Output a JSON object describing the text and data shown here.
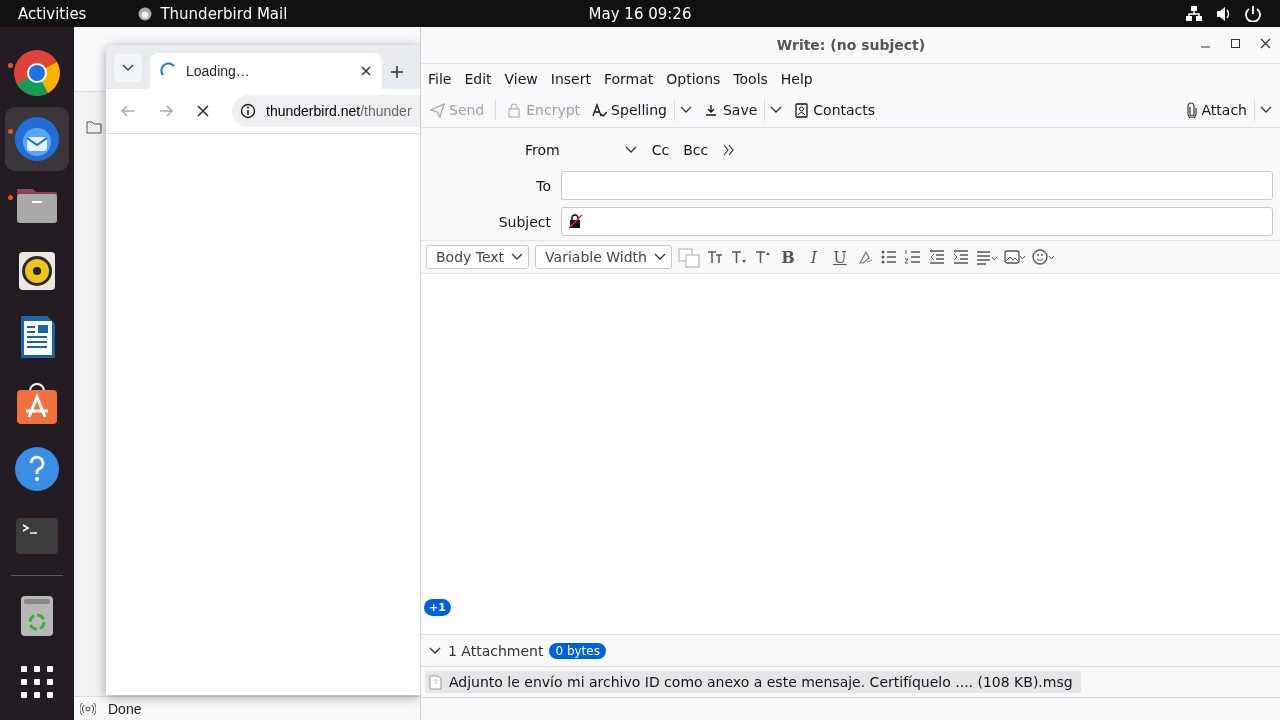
{
  "top_bar": {
    "activities": "Activities",
    "app_name": "Thunderbird Mail",
    "clock": "May 16  09:26"
  },
  "dock": {
    "apps": [
      {
        "kind": "chrome",
        "running": true,
        "selected": false
      },
      {
        "kind": "thunderbird",
        "running": true,
        "selected": true
      },
      {
        "kind": "files",
        "running": true,
        "selected": false
      },
      {
        "kind": "rhythmbox",
        "running": false,
        "selected": false
      },
      {
        "kind": "writer",
        "running": false,
        "selected": false
      },
      {
        "kind": "store",
        "running": false,
        "selected": false
      },
      {
        "kind": "help",
        "running": false,
        "selected": false
      },
      {
        "kind": "terminal",
        "running": false,
        "selected": false
      },
      {
        "kind": "trash",
        "running": false,
        "selected": false
      },
      {
        "kind": "apps",
        "running": false,
        "selected": false
      }
    ]
  },
  "main_window": {
    "status": "Done"
  },
  "browser": {
    "tab_title": "Loading…",
    "url_host": "thunderbird.net",
    "url_path": "/thunder"
  },
  "compose": {
    "title": "Write: (no subject)",
    "menu": [
      "File",
      "Edit",
      "View",
      "Insert",
      "Format",
      "Options",
      "Tools",
      "Help"
    ],
    "toolbar": [
      {
        "kind": "send",
        "label": "Send",
        "disabled": true,
        "dropdown": false
      },
      {
        "kind": "encrypt",
        "label": "Encrypt",
        "disabled": true,
        "dropdown": false
      },
      {
        "kind": "spelling",
        "label": "Spelling",
        "disabled": false,
        "dropdown": true
      },
      {
        "kind": "save",
        "label": "Save",
        "disabled": false,
        "dropdown": true
      },
      {
        "kind": "contacts",
        "label": "Contacts",
        "disabled": false,
        "dropdown": false
      }
    ],
    "attach_button": {
      "label": "Attach",
      "dropdown": true
    },
    "from_label": "From",
    "cc": "Cc",
    "bcc": "Bcc",
    "to_label": "To",
    "subject_label": "Subject",
    "paragraph_format": "Body Text",
    "font": "Variable Width",
    "format_buttons": [
      {
        "kind": "color"
      },
      {
        "kind": "smaller"
      },
      {
        "kind": "subscript"
      },
      {
        "kind": "superscript"
      },
      {
        "kind": "bold",
        "label": "B"
      },
      {
        "kind": "italic",
        "label": "I"
      },
      {
        "kind": "underline",
        "label": "U"
      },
      {
        "kind": "clear"
      },
      {
        "kind": "bullets"
      },
      {
        "kind": "numbers"
      },
      {
        "kind": "outdent"
      },
      {
        "kind": "indent"
      },
      {
        "kind": "align"
      },
      {
        "kind": "image"
      },
      {
        "kind": "emoji"
      }
    ],
    "badge": "+1",
    "attachments": {
      "summary": "1 Attachment",
      "size": "0 bytes",
      "expanded": true,
      "files": [
        "Adjunto le envío mi archivo ID como anexo a este mensaje. Certifíquelo .... (108 KB).msg"
      ]
    }
  }
}
